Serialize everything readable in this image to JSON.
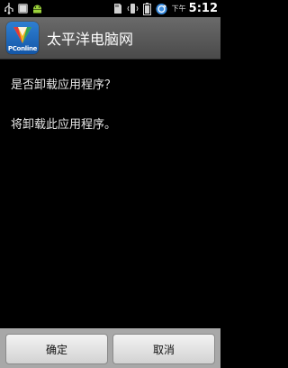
{
  "status_bar": {
    "ampm": "下午",
    "time": "5:12",
    "icons": [
      "usb-icon",
      "android-debug-icon",
      "sd-card-icon",
      "vibrate-icon",
      "battery-icon",
      "sync-icon"
    ]
  },
  "app": {
    "title": "太平洋电脑网",
    "icon_brand": "PConline"
  },
  "dialog": {
    "question": "是否卸载应用程序？",
    "message": "将卸载此应用程序。"
  },
  "buttons": {
    "ok_label": "确定",
    "cancel_label": "取消"
  }
}
